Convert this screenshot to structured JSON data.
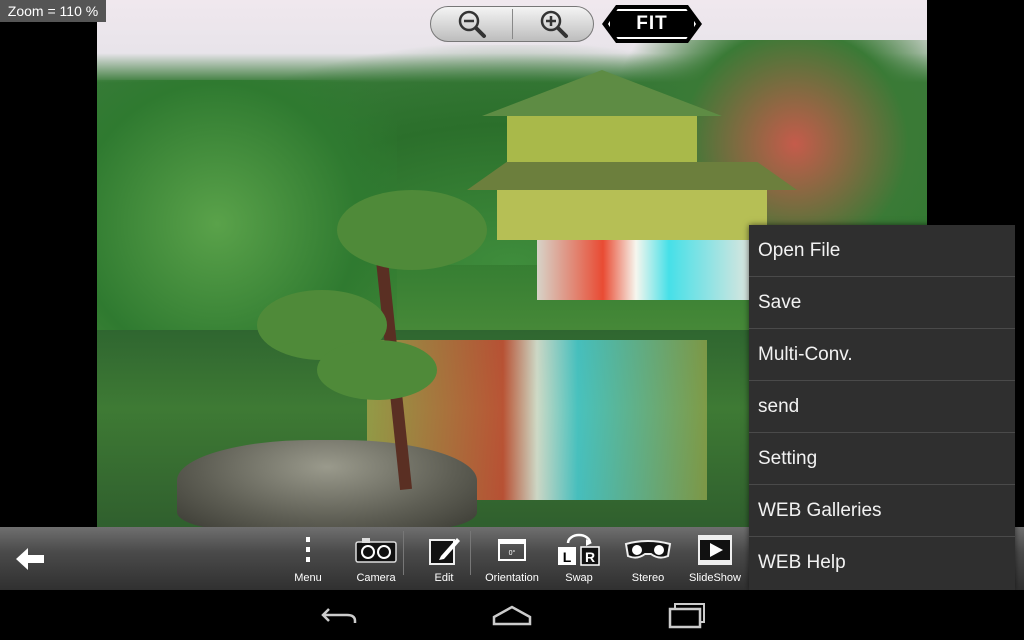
{
  "zoom": {
    "label": "Zoom = 110 %"
  },
  "zoom_controls": {
    "zoom_out_icon": "magnifier-minus-icon",
    "zoom_in_icon": "magnifier-plus-icon"
  },
  "fit_button": {
    "label": "FIT"
  },
  "toolbar": {
    "back_icon": "arrow-left-icon",
    "items": [
      {
        "label": "Menu",
        "icon": "vertical-dots-icon"
      },
      {
        "label": "Camera",
        "icon": "camera-icon"
      },
      {
        "label": "Edit",
        "icon": "edit-icon"
      },
      {
        "label": "Orientation",
        "icon": "orientation-icon"
      },
      {
        "label": "Swap",
        "icon": "swap-lr-icon"
      },
      {
        "label": "Stereo",
        "icon": "stereo-glasses-icon"
      },
      {
        "label": "SlideShow",
        "icon": "slideshow-play-icon"
      }
    ]
  },
  "menu": {
    "items": [
      {
        "label": "Open File"
      },
      {
        "label": "Save"
      },
      {
        "label": "Multi-Conv."
      },
      {
        "label": "send"
      },
      {
        "label": "Setting"
      },
      {
        "label": "WEB Galleries"
      },
      {
        "label": "WEB Help"
      }
    ]
  },
  "navbar": {
    "back_icon": "nav-back-icon",
    "home_icon": "nav-home-icon",
    "recents_icon": "nav-recents-icon"
  },
  "colors": {
    "menu_bg": "#2f2f2f",
    "toolbar_bg": "#4a4a4a",
    "zoom_label_bg": "#555555"
  }
}
